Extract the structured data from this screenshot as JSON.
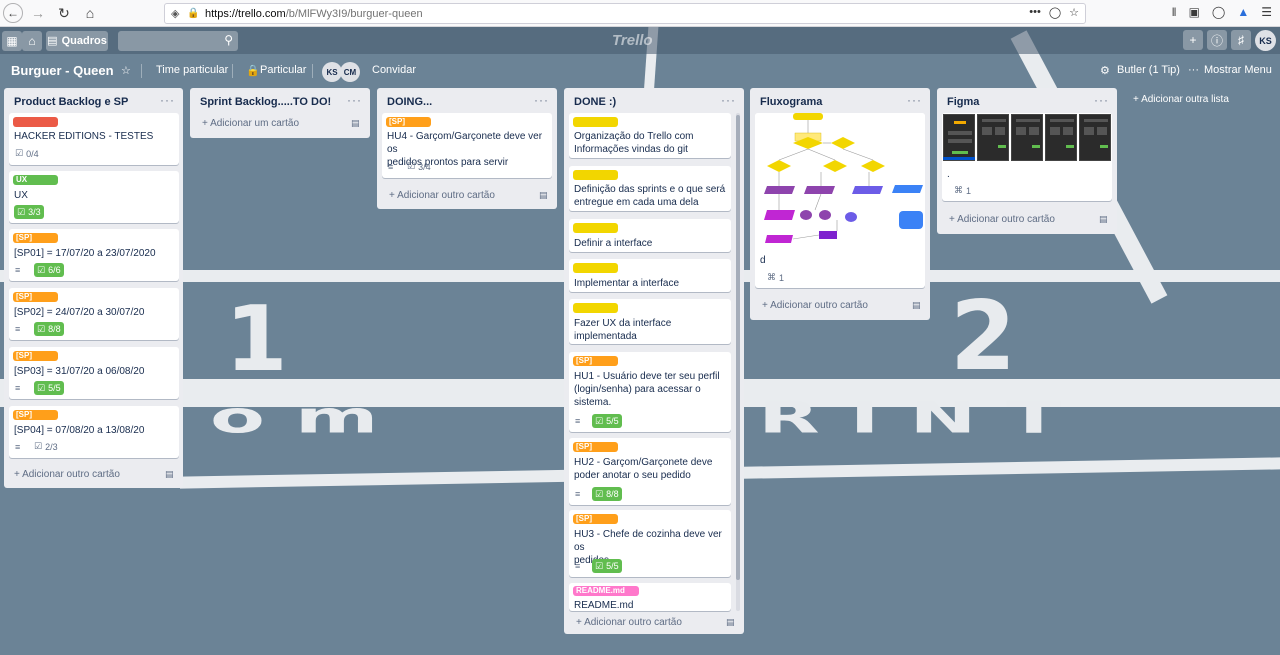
{
  "browser": {
    "url_host": "https://trello.com",
    "url_path": "/b/MlFWy3I9/burguer-queen",
    "url_actions": "•••"
  },
  "trello_header": {
    "boards_label": "Quadros",
    "logo": "Trello",
    "avatar": "KS"
  },
  "board": {
    "title": "Burguer - Queen",
    "team": "Time particular",
    "visibility": "Particular",
    "members": [
      "KS",
      "CM"
    ],
    "invite": "Convidar",
    "butler": "Butler (1 Tip)",
    "show_menu": "Mostrar Menu"
  },
  "lists": [
    {
      "title": "Product Backlog e SP",
      "add_card": "Adicionar outro cartão",
      "cards": [
        {
          "label": "",
          "label_color": "#eb5a46",
          "text": "HACKER EDITIONS - TESTES",
          "checklist": "0/4"
        },
        {
          "label": "UX",
          "label_color": "#61bd4f",
          "text": "UX",
          "checklist": "3/3"
        },
        {
          "label": "[SP]",
          "label_color": "#ff9f1a",
          "text": "[SP01] = 17/07/20 a 23/07/2020",
          "checklist": "6/6"
        },
        {
          "label": "[SP]",
          "label_color": "#ff9f1a",
          "text": "[SP02] = 24/07/20 a 30/07/20",
          "checklist": "8/8"
        },
        {
          "label": "[SP]",
          "label_color": "#ff9f1a",
          "text": "[SP03] = 31/07/20 a 06/08/20",
          "checklist": "5/5"
        },
        {
          "label": "[SP]",
          "label_color": "#ff9f1a",
          "text": "[SP04] = 07/08/20 a 13/08/20",
          "checklist": "2/3"
        }
      ]
    },
    {
      "title": "Sprint Backlog.....TO DO!",
      "add_card": "Adicionar um cartão",
      "cards": []
    },
    {
      "title": "DOING...",
      "add_card": "Adicionar outro cartão",
      "cards": [
        {
          "label": "[SP]",
          "label_color": "#ff9f1a",
          "text_line1": "HU4 - Garçom/Garçonete deve ver os",
          "text_line2": "pedidos prontos para servir",
          "checklist": "3/4"
        }
      ]
    },
    {
      "title": "DONE :)",
      "add_card": "Adicionar outro cartão",
      "cards": [
        {
          "label": "",
          "text_line1": "Organização do Trello com",
          "text_line2": "Informações vindas do git"
        },
        {
          "label": "",
          "text_line1": "Definição das sprints e o que será",
          "text_line2": "entregue em cada uma dela"
        },
        {
          "label": "",
          "text_line1": "Definir a interface"
        },
        {
          "label": "",
          "text_line1": "Implementar a interface"
        },
        {
          "label": "",
          "text_line1": "Fazer UX da interface",
          "text_line2": "implementada"
        },
        {
          "label": "[SP]",
          "text_line1": "HU1 - Usuário deve ter seu perfil",
          "text_line2": "(login/senha) para acessar o",
          "text_line3": "sistema.",
          "checklist": "5/5"
        },
        {
          "label": "[SP]",
          "text_line1": "HU2 - Garçom/Garçonete deve",
          "text_line2": "poder anotar o seu pedido",
          "checklist": "8/8"
        },
        {
          "label": "[SP]",
          "text_line1": "HU3 - Chefe de cozinha deve ver os",
          "text_line2": "pedidos",
          "checklist": "5/5"
        },
        {
          "label": "README.md",
          "text_line1": "README.md"
        }
      ]
    },
    {
      "title": "Fluxograma",
      "add_card": "Adicionar outro cartão",
      "cards": [
        {
          "text": "d",
          "attachments": "1"
        }
      ]
    },
    {
      "title": "Figma",
      "add_card": "Adicionar outro cartão",
      "cards": [
        {
          "text": ".",
          "attachments": "1"
        }
      ]
    }
  ],
  "add_list": "Adicionar outra lista",
  "colors": {
    "list_bg": "#ebecf0",
    "label_red": "#eb5a46",
    "label_green": "#61bd4f",
    "label_orange": "#ff9f1a",
    "label_yellow": "#f2d600",
    "label_pink": "#ff78cb"
  }
}
